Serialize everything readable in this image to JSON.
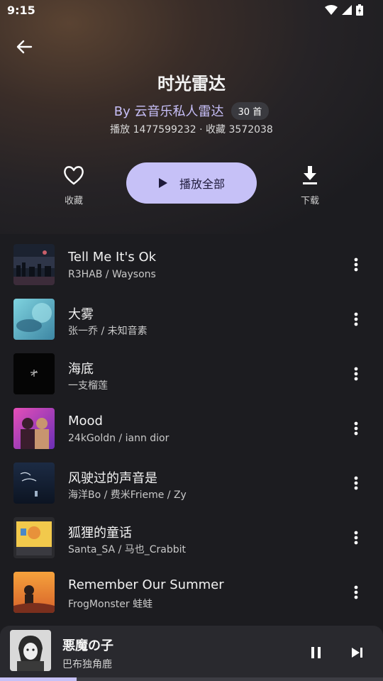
{
  "status_bar": {
    "time": "9:15"
  },
  "playlist": {
    "title": "时光雷达",
    "creator": "By 云音乐私人雷达",
    "track_count": "30 首",
    "stats": "播放 1477599232 · 收藏 3572038"
  },
  "actions": {
    "favorite_label": "收藏",
    "play_all_label": "播放全部",
    "download_label": "下载"
  },
  "songs": [
    {
      "title": "Tell Me It's Ok",
      "artist": "R3HAB / Waysons"
    },
    {
      "title": "大雾",
      "artist": "张一乔 / 未知音素"
    },
    {
      "title": "海底",
      "artist": "一支榴莲"
    },
    {
      "title": "Mood",
      "artist": "24kGoldn / iann dior"
    },
    {
      "title": "风驶过的声音是",
      "artist": "海洋Bo / 费米Frieme / Zy"
    },
    {
      "title": "狐狸的童话",
      "artist": "Santa_SA / 马也_Crabbit"
    },
    {
      "title": "Remember Our Summer",
      "artist": "FrogMonster 蛙蛙"
    }
  ],
  "now_playing": {
    "title": "悪魔の子",
    "artist": "巴布独角鹿",
    "progress": 0.2
  },
  "colors": {
    "accent": "#c6c1f7",
    "creator_text": "#c7bff8",
    "background": "#1c1c20",
    "mini_player": "#29292e"
  }
}
